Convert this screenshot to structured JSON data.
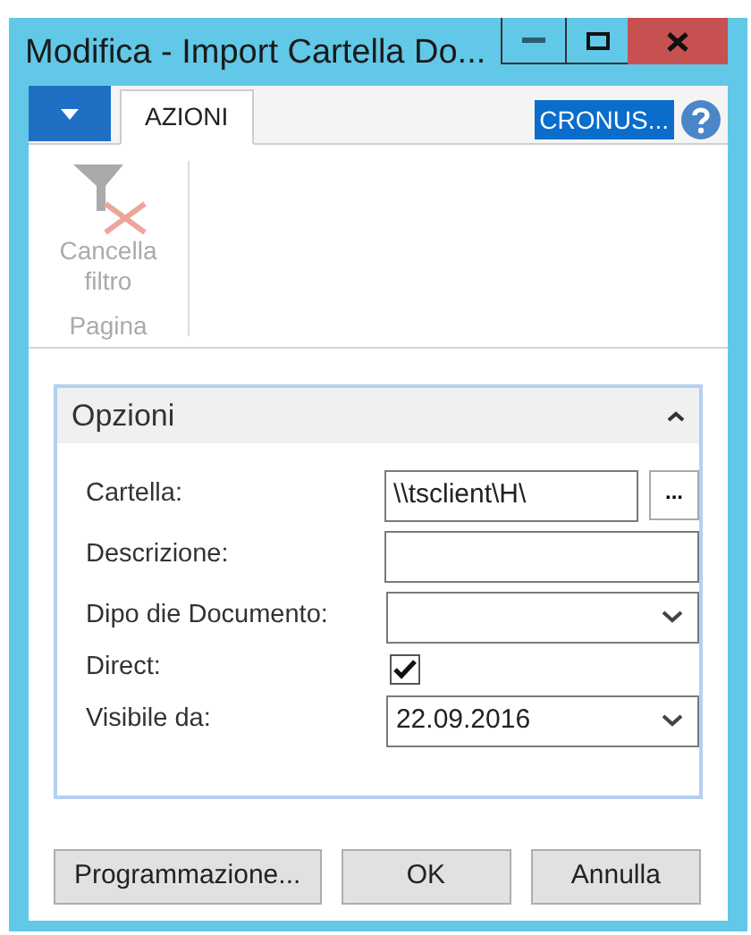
{
  "window": {
    "title": "Modifica - Import Cartella Do..."
  },
  "ribbon": {
    "tabs": [
      {
        "label": "AZIONI",
        "selected": true
      }
    ],
    "company": "CRONUS...",
    "actions": [
      {
        "label": "Cancella filtro",
        "disabled": true
      }
    ],
    "group": "Pagina"
  },
  "section": {
    "title": "Opzioni",
    "expanded": true,
    "fields": [
      {
        "kind": "text",
        "label": "Cartella:",
        "value": "\\\\tsclient\\H\\",
        "lookup": "..."
      },
      {
        "kind": "text",
        "label": "Descrizione:"
      },
      {
        "kind": "select",
        "label": "Dipo die Documento:"
      },
      {
        "kind": "checkbox",
        "label": "Direct:",
        "checked": true
      },
      {
        "kind": "select",
        "label": "Visibile da:",
        "value": "22.09.2016"
      }
    ]
  },
  "buttons": [
    "Programmazione...",
    "OK",
    "Annulla"
  ]
}
